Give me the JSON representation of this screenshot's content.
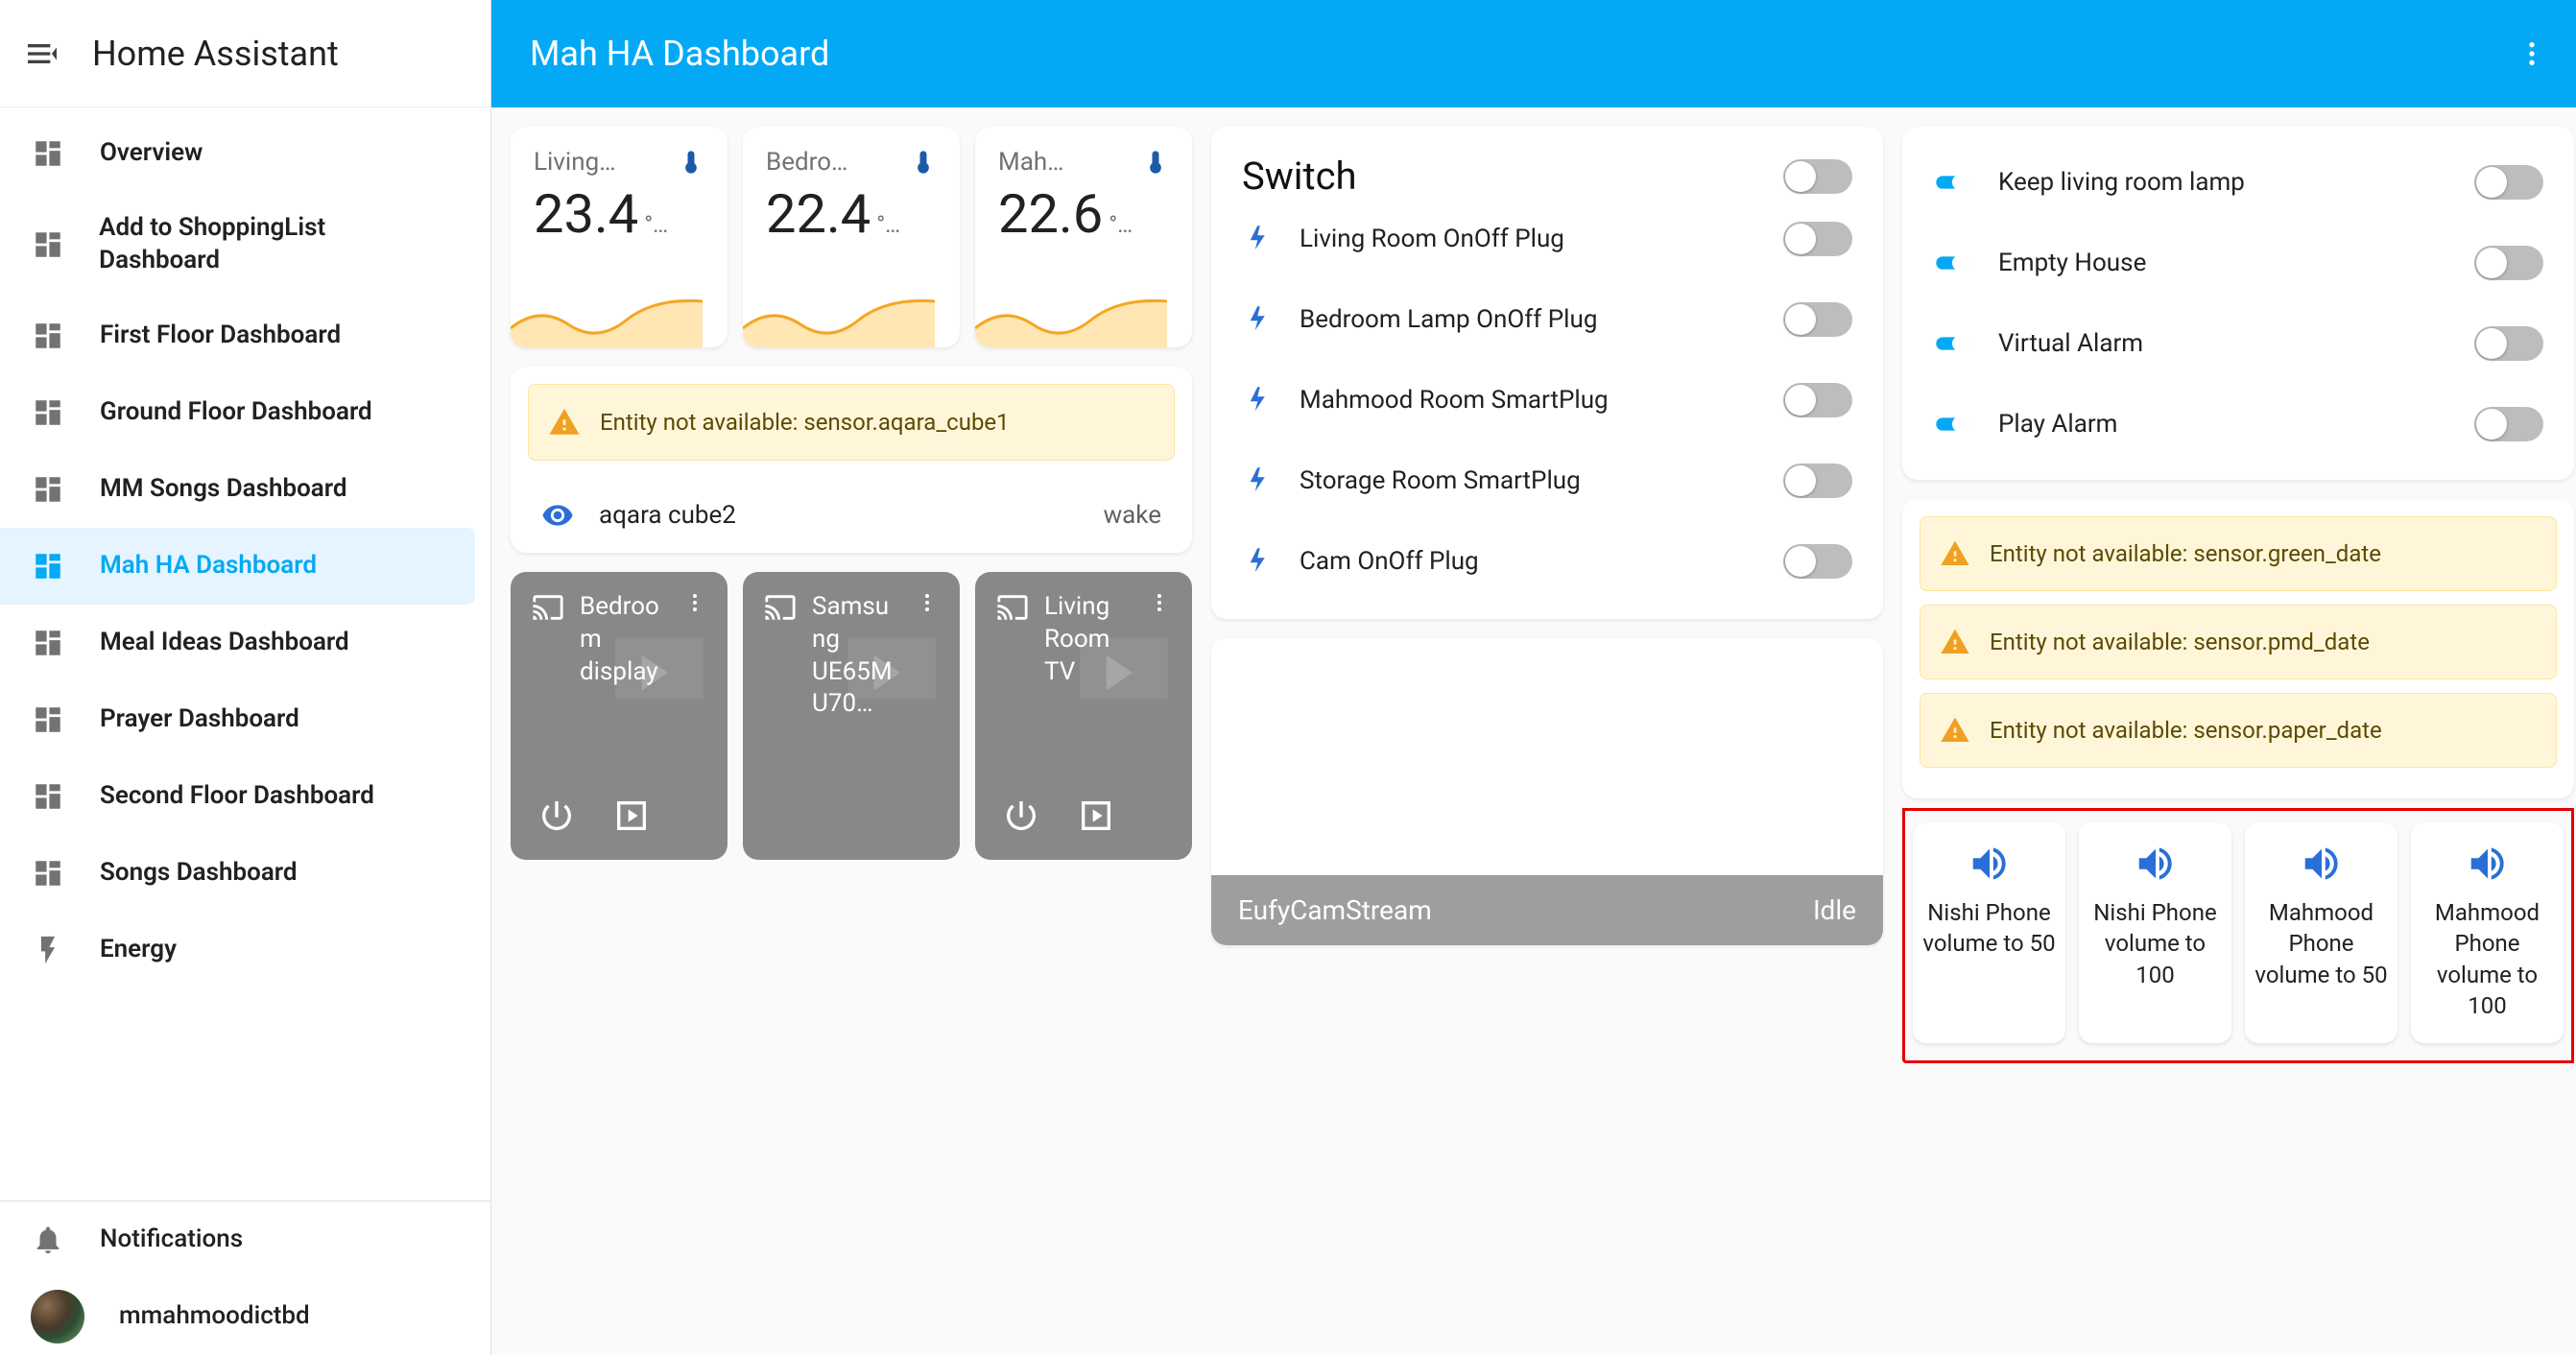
{
  "app_title": "Home Assistant",
  "header": {
    "title": "Mah HA Dashboard"
  },
  "sidebar": {
    "items": [
      {
        "label": "Overview",
        "icon": "dashboard"
      },
      {
        "label": "Add to ShoppingList Dashboard",
        "icon": "dashboard"
      },
      {
        "label": "First Floor Dashboard",
        "icon": "dashboard"
      },
      {
        "label": "Ground Floor Dashboard",
        "icon": "dashboard"
      },
      {
        "label": "MM Songs Dashboard",
        "icon": "dashboard"
      },
      {
        "label": "Mah HA Dashboard",
        "icon": "dashboard",
        "active": true
      },
      {
        "label": "Meal Ideas Dashboard",
        "icon": "dashboard"
      },
      {
        "label": "Prayer Dashboard",
        "icon": "dashboard"
      },
      {
        "label": "Second Floor Dashboard",
        "icon": "dashboard"
      },
      {
        "label": "Songs Dashboard",
        "icon": "dashboard"
      },
      {
        "label": "Energy",
        "icon": "flash"
      }
    ],
    "notifications_label": "Notifications",
    "user_label": "mmahmoodictbd"
  },
  "sensors": [
    {
      "name": "Living…",
      "value": "23.4",
      "unit": "°…"
    },
    {
      "name": "Bedro…",
      "value": "22.4",
      "unit": "°…"
    },
    {
      "name": "Mah…",
      "value": "22.6",
      "unit": "°…"
    }
  ],
  "entity_list": {
    "error": "Entity not available: sensor.aqara_cube1",
    "rows": [
      {
        "icon": "eye",
        "label": "aqara cube2",
        "trail": "wake"
      }
    ]
  },
  "media": [
    {
      "name": "Bedroom display"
    },
    {
      "name": "Samsung UE65MU70…",
      "no_controls": true
    },
    {
      "name": "Living Room TV"
    }
  ],
  "switches": {
    "title": "Switch",
    "group_on": false,
    "items": [
      {
        "label": "Living Room OnOff Plug",
        "on": false
      },
      {
        "label": "Bedroom Lamp OnOff Plug",
        "on": false
      },
      {
        "label": "Mahmood Room SmartPlug",
        "on": false
      },
      {
        "label": "Storage Room SmartPlug",
        "on": false
      },
      {
        "label": "Cam OnOff Plug",
        "on": false
      }
    ]
  },
  "cam": {
    "name": "EufyCamStream",
    "state": "Idle"
  },
  "automations": [
    {
      "label": "Keep living room lamp",
      "icon_on": true,
      "toggle": false
    },
    {
      "label": "Empty House",
      "icon_on": true,
      "toggle": false
    },
    {
      "label": "Virtual Alarm",
      "icon_on": true,
      "toggle": false
    },
    {
      "label": "Play Alarm",
      "icon_on": true,
      "toggle": false
    }
  ],
  "warnings": [
    "Entity not available: sensor.green_date",
    "Entity not available: sensor.pmd_date",
    "Entity not available: sensor.paper_date"
  ],
  "volume_buttons": [
    {
      "label": "Nishi Phone volume to 50"
    },
    {
      "label": "Nishi Phone volume to 100"
    },
    {
      "label": "Mahmood Phone volume to 50"
    },
    {
      "label": "Mahmood Phone volume to 100"
    }
  ]
}
